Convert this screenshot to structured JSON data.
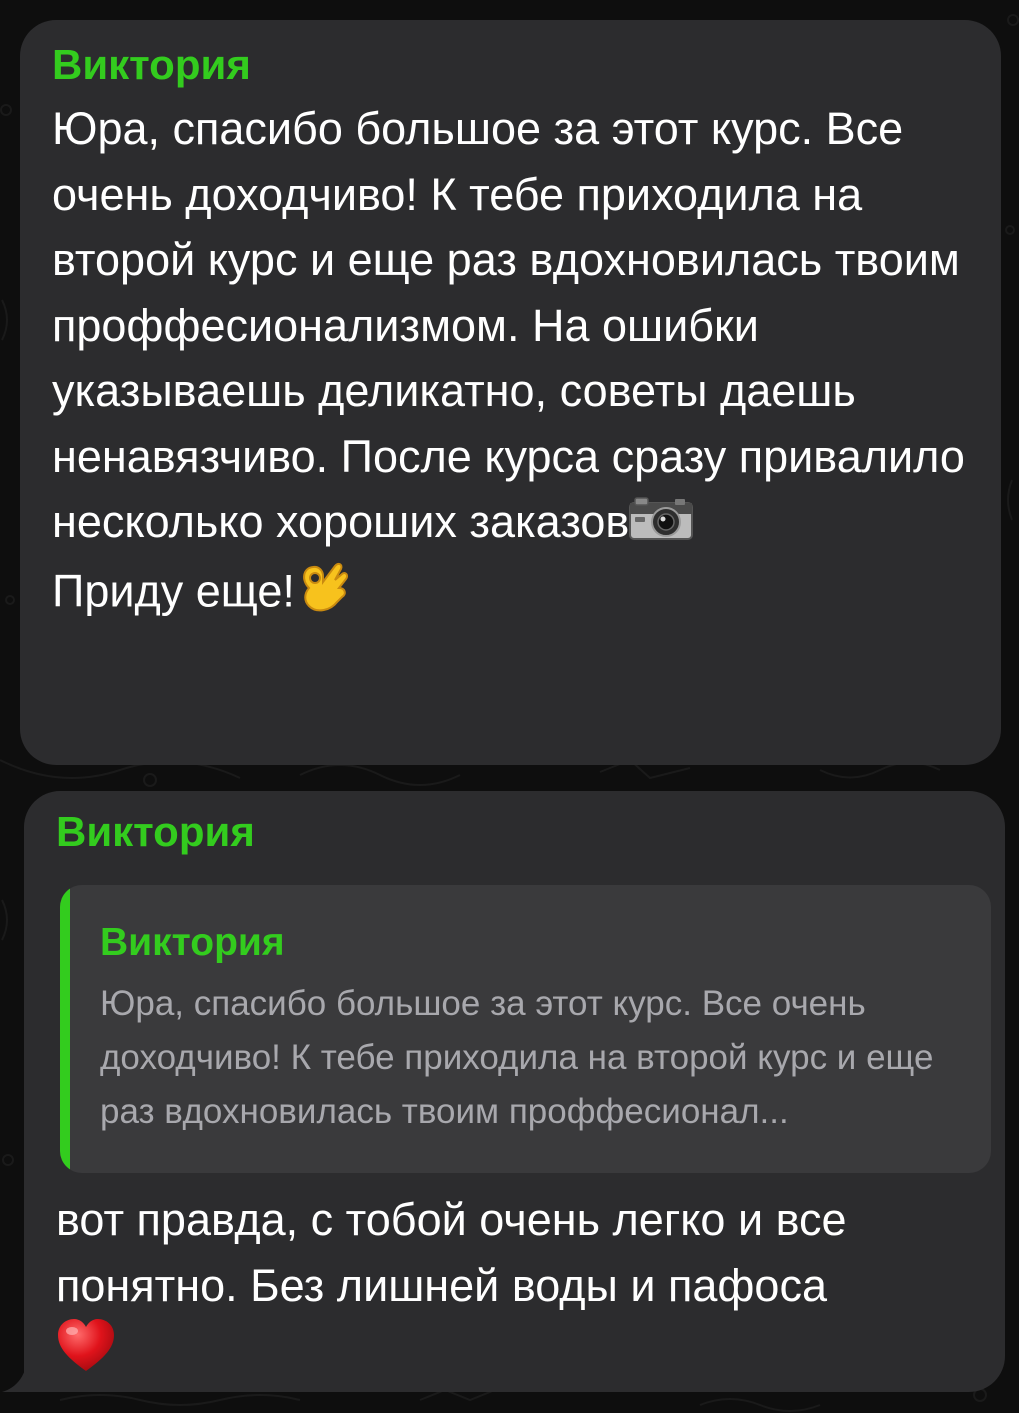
{
  "messages": [
    {
      "sender": "Виктория",
      "text": "Юра, спасибо большое за этот курс. Все очень доходчиво! К тебе приходила на второй курс и еще раз вдохновилась твоим проффесионализмом. На ошибки указываешь деликатно, советы даешь ненавязчиво. После курса сразу привалило несколько хороших заказов",
      "text_end_icon": "camera-emoji",
      "text_line2": "Приду еще!",
      "text_line2_icon": "ok-hand-emoji"
    },
    {
      "sender": "Виктория",
      "quote": {
        "sender": "Виктория",
        "text": "Юра, спасибо большое за этот курс. Все очень доходчиво! К тебе приходила на второй курс и еще раз вдохновилась твоим проффесионал..."
      },
      "text": "вот правда, с тобой очень легко и все понятно. Без лишней воды и пафоса",
      "text_end_icon": "red-heart-emoji"
    }
  ],
  "colors": {
    "background": "#0e0e0e",
    "bubble": "#2c2c2e",
    "quote_background": "#3a3a3c",
    "accent_green": "#33cc1e",
    "text": "#ffffff",
    "quote_text": "#a8a8ad"
  }
}
